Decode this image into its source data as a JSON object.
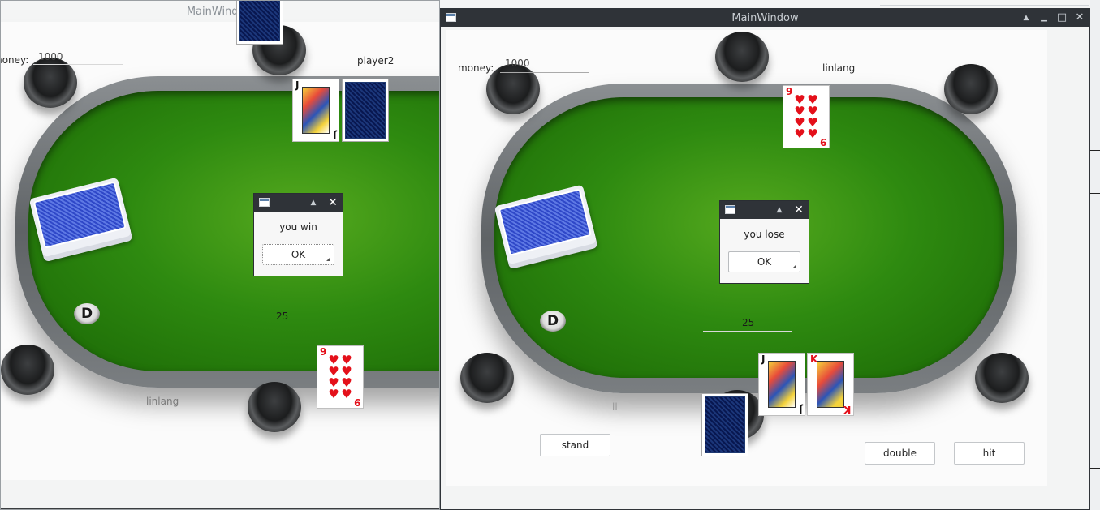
{
  "window_left": {
    "title": "MainWindow",
    "money_label": "money:",
    "money_value": "1000",
    "opponent_name": "player2",
    "player_name": "linlang",
    "bet": "25",
    "dealer_button": "D",
    "opponent_cards": [
      {
        "rank": "J",
        "suit": "♠",
        "color": "black",
        "face": true
      }
    ],
    "player_cards": [
      {
        "rank": "9",
        "suit": "♥",
        "color": "red",
        "pips": 9
      }
    ],
    "dialog": {
      "message": "you win",
      "ok_label": "OK"
    }
  },
  "window_right": {
    "title": "MainWindow",
    "money_label": "money:",
    "money_value": "1000",
    "opponent_name": "linlang",
    "player_name": "ll",
    "bet": "25",
    "dealer_button": "D",
    "opponent_cards": [
      {
        "rank": "9",
        "suit": "♥",
        "color": "red",
        "pips": 9
      }
    ],
    "player_cards": [
      {
        "rank": "J",
        "suit": "♠",
        "color": "black",
        "face": true
      },
      {
        "rank": "K",
        "suit": "♥",
        "color": "red",
        "face": true
      }
    ],
    "dialog": {
      "message": "you lose",
      "ok_label": "OK"
    },
    "buttons": {
      "stand": "stand",
      "double": "double",
      "hit": "hit"
    }
  },
  "window_controls": {
    "minimize": "▁",
    "maximize": "□",
    "close": "✕",
    "shade": "▲"
  }
}
